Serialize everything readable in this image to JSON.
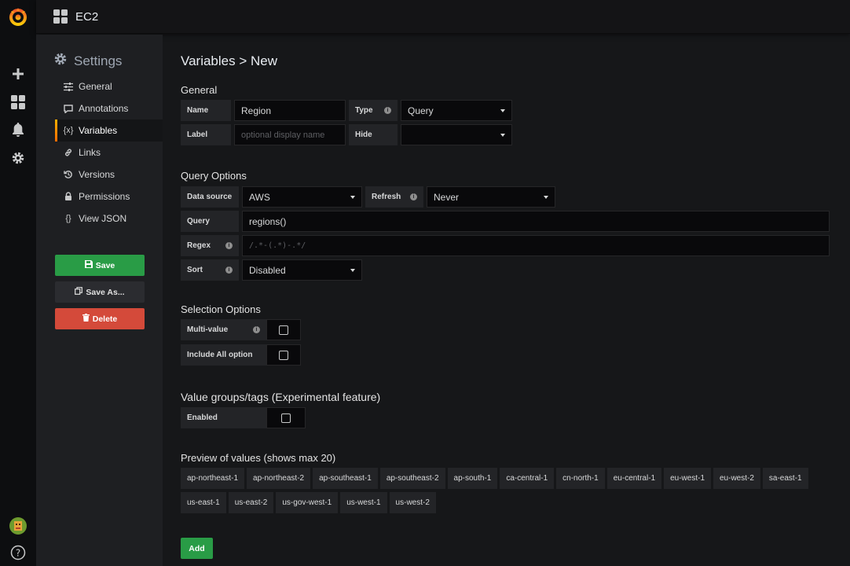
{
  "app": {
    "dashboard_title": "EC2",
    "icons": {
      "logo": "grafana-logo-icon",
      "create": "plus-icon",
      "dashboards": "dashboards-grid-icon",
      "alerting": "bell-icon",
      "configuration": "gear-icon",
      "profile": "avatar-icon",
      "help": "help-icon"
    },
    "colors": {
      "accent": "#ff8833",
      "success": "#299c46",
      "danger": "#d44a3a"
    }
  },
  "sidebar": {
    "title": "Settings",
    "items": [
      {
        "label": "General",
        "icon": "sliders-icon"
      },
      {
        "label": "Annotations",
        "icon": "comment-icon"
      },
      {
        "label": "Variables",
        "icon": "variable-icon",
        "active": true
      },
      {
        "label": "Links",
        "icon": "link-icon"
      },
      {
        "label": "Versions",
        "icon": "history-icon"
      },
      {
        "label": "Permissions",
        "icon": "lock-icon"
      },
      {
        "label": "View JSON",
        "icon": "json-icon"
      }
    ],
    "save_label": "Save",
    "save_as_label": "Save As...",
    "delete_label": "Delete"
  },
  "main": {
    "title": "Variables > New",
    "general": {
      "heading": "General",
      "name_label": "Name",
      "name_value": "Region",
      "type_label": "Type",
      "type_value": "Query",
      "label_label": "Label",
      "label_placeholder": "optional display name",
      "hide_label": "Hide",
      "hide_value": ""
    },
    "query_options": {
      "heading": "Query Options",
      "datasource_label": "Data source",
      "datasource_value": "AWS",
      "refresh_label": "Refresh",
      "refresh_value": "Never",
      "query_label": "Query",
      "query_value": "regions()",
      "regex_label": "Regex",
      "regex_placeholder": "/.*-(.*)-.*/",
      "sort_label": "Sort",
      "sort_value": "Disabled"
    },
    "selection_options": {
      "heading": "Selection Options",
      "multi_label": "Multi-value",
      "include_all_label": "Include All option"
    },
    "value_groups": {
      "heading": "Value groups/tags (Experimental feature)",
      "enabled_label": "Enabled"
    },
    "preview": {
      "heading": "Preview of values (shows max 20)",
      "values_row1": [
        "ap-northeast-1",
        "ap-northeast-2",
        "ap-southeast-1",
        "ap-southeast-2",
        "ap-south-1",
        "ca-central-1",
        "cn-north-1",
        "eu-central-1",
        "eu-west-1",
        "eu-west-2",
        "sa-east-1"
      ],
      "values_row2": [
        "us-east-1",
        "us-east-2",
        "us-gov-west-1",
        "us-west-1",
        "us-west-2"
      ]
    },
    "add_label": "Add"
  }
}
